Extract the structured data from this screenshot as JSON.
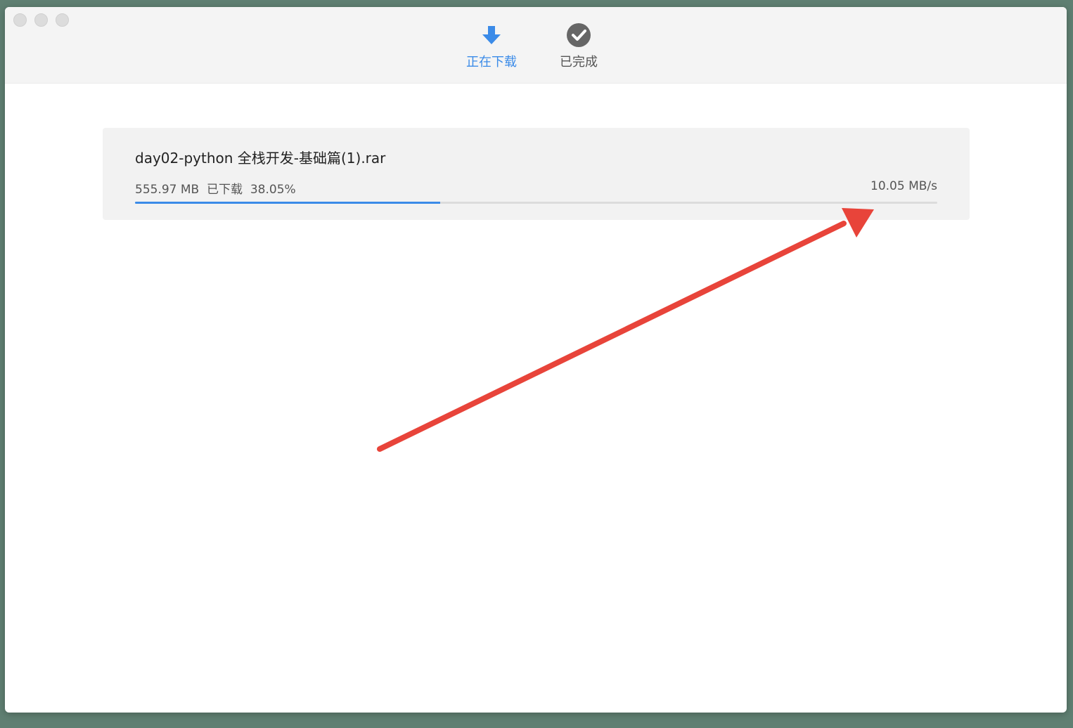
{
  "tabs": [
    {
      "label": "正在下载",
      "icon": "download-arrow-icon",
      "active": true
    },
    {
      "label": "已完成",
      "icon": "check-circle-icon",
      "active": false
    }
  ],
  "download": {
    "filename": "day02-python 全栈开发-基础篇(1).rar",
    "size": "555.97 MB",
    "status": "已下载",
    "percent": "38.05%",
    "progress_fraction": 0.3805,
    "speed": "10.05 MB/s"
  },
  "colors": {
    "accent": "#3b8be8",
    "annotation_arrow": "#e8443a"
  }
}
